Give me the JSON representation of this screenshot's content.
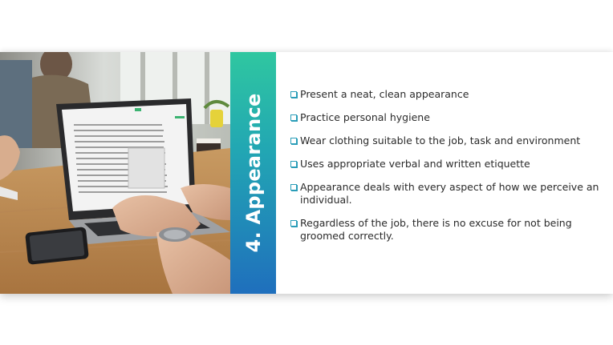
{
  "slide": {
    "title": "4. Appearance",
    "bullets": [
      "Present a neat, clean appearance",
      "Practice personal hygiene",
      "Wear clothing suitable to the job, task and environment",
      "Uses appropriate verbal and written etiquette",
      "Appearance deals with every aspect of how we perceive an individual.",
      "Regardless of the job, there is no excuse for not being groomed correctly."
    ]
  },
  "colors": {
    "gradient_top": "#2fc7a0",
    "gradient_bottom": "#1f6fbd",
    "bullet_marker": "#2a9db8",
    "text": "#2b2b2b"
  },
  "icons": {
    "bullet": "checkbox-bullet-icon",
    "photo": "laptop-workspace-photo"
  }
}
